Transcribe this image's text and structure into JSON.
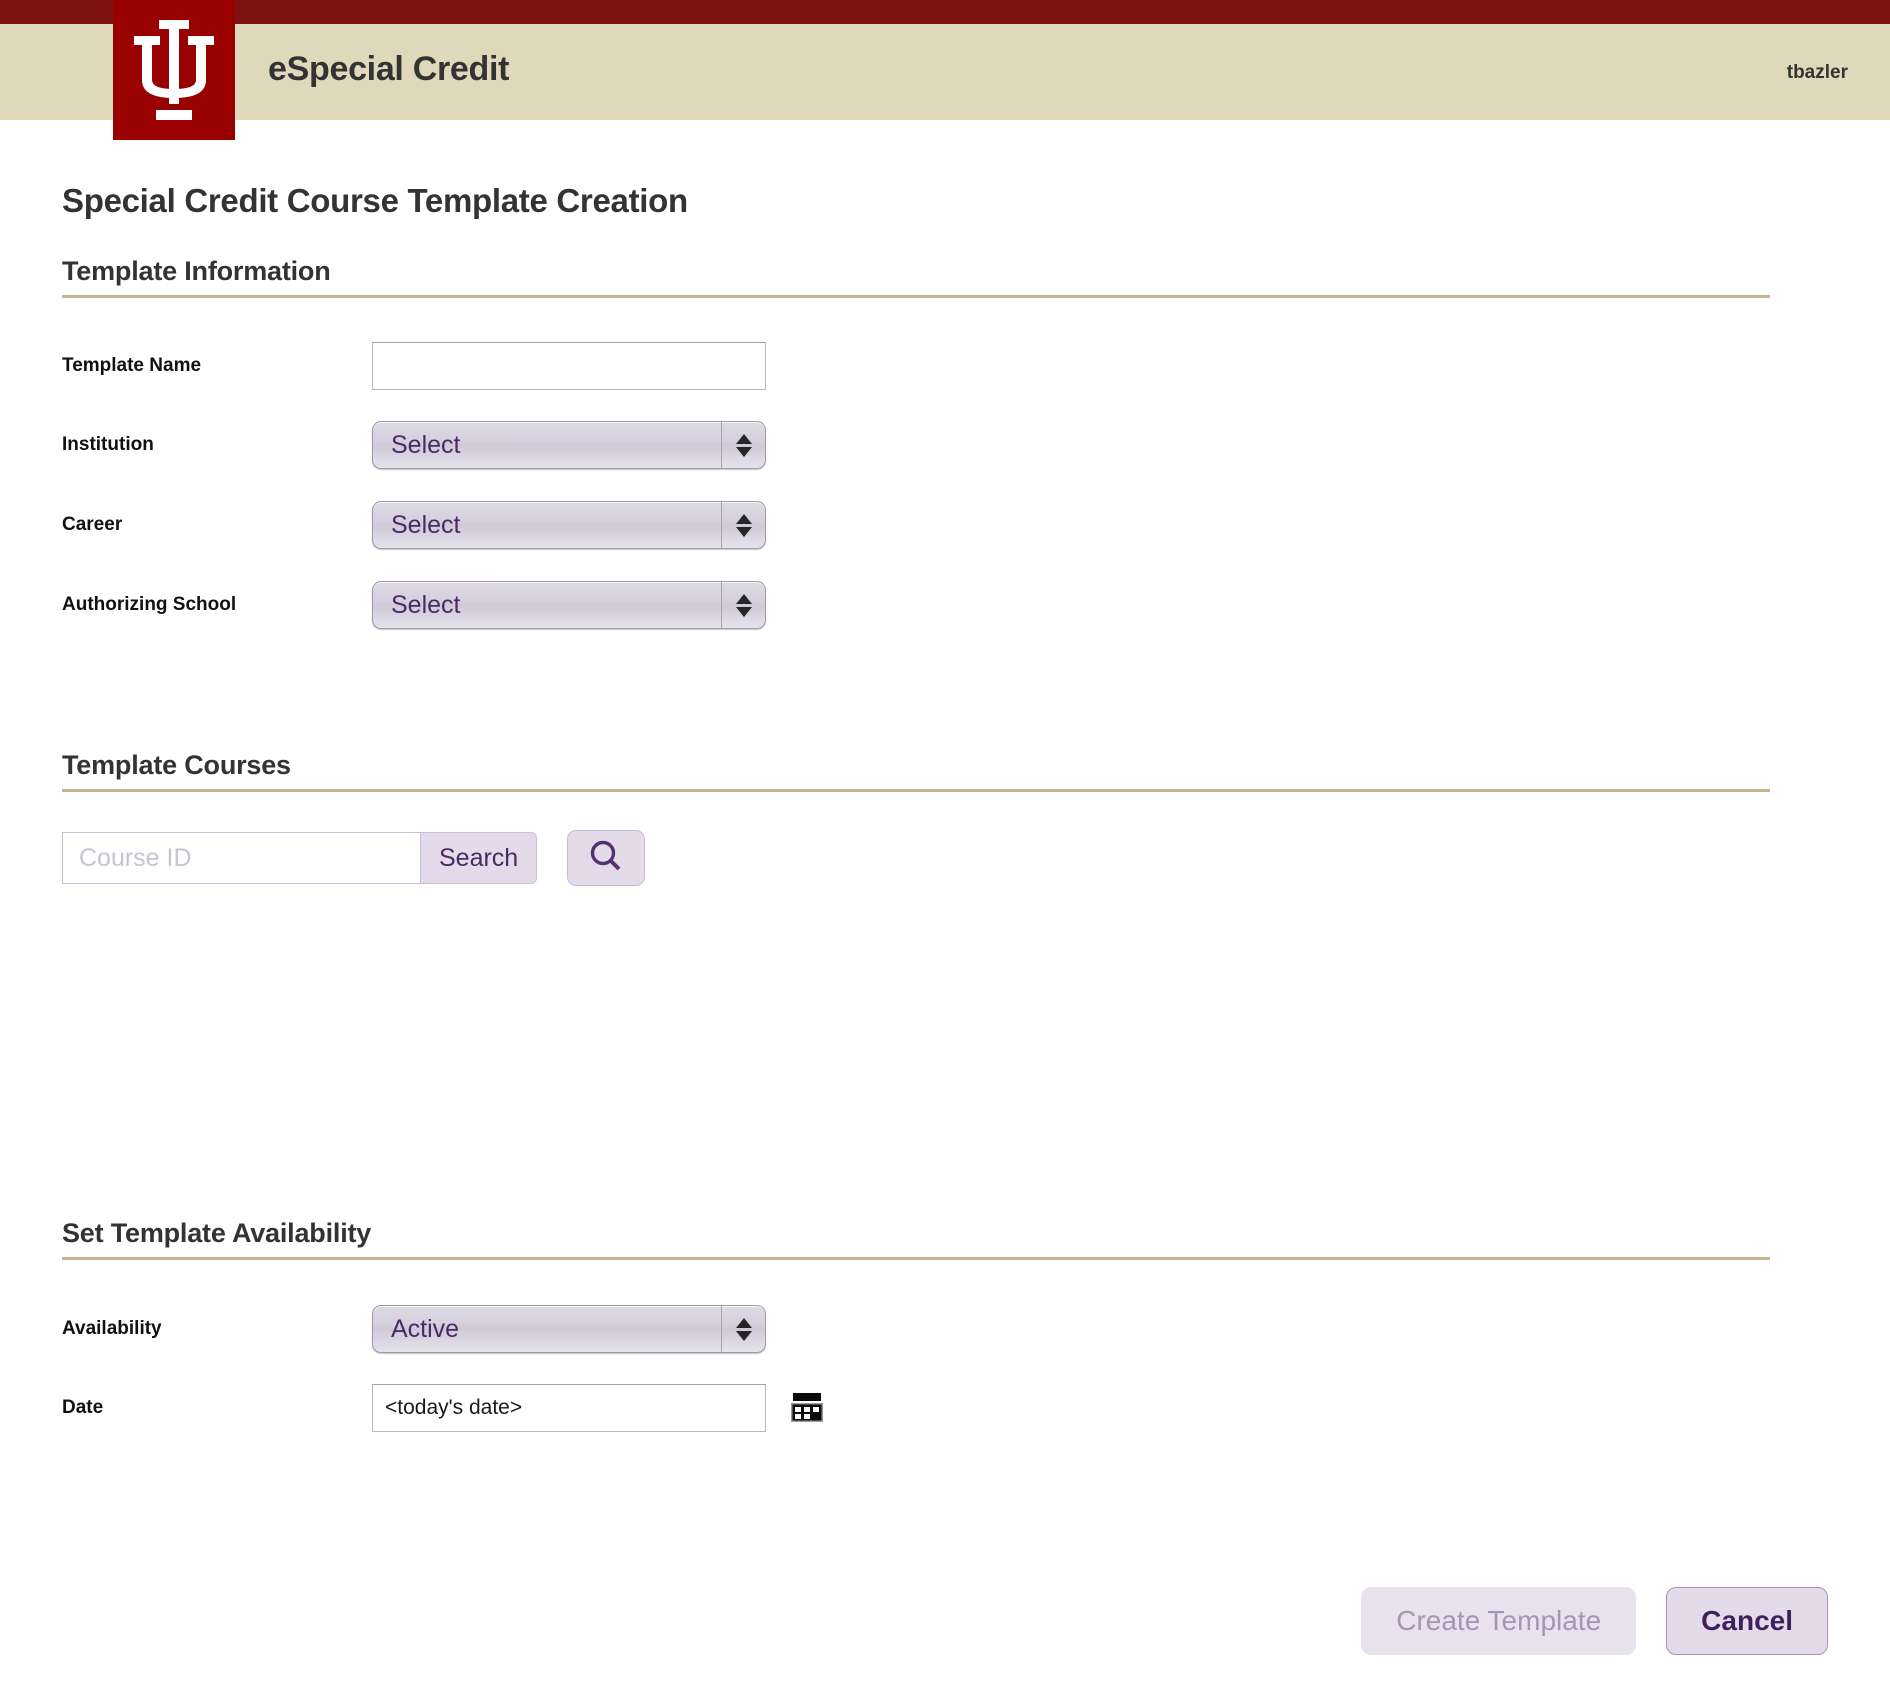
{
  "header": {
    "app_title": "eSpecial Credit",
    "username": "tbazler",
    "logo_icon": "iu-trident-logo",
    "strip_color": "#7d1210",
    "band_color": "#e0d8bb",
    "logo_color": "#990000"
  },
  "page": {
    "title": "Special Credit Course Template Creation",
    "rule_color": "#c5b68f"
  },
  "sections": {
    "template_information": {
      "title": "Template Information",
      "fields": {
        "template_name": {
          "label": "Template Name",
          "value": "",
          "placeholder": ""
        },
        "institution": {
          "label": "Institution",
          "value": "Select"
        },
        "career": {
          "label": "Career",
          "value": "Select"
        },
        "authorizing_school": {
          "label": "Authorizing School",
          "value": "Select"
        }
      }
    },
    "template_courses": {
      "title": "Template Courses",
      "search": {
        "placeholder": "Course ID",
        "value": "",
        "button_label": "Search",
        "magnifier_icon": "search-icon"
      }
    },
    "set_template_availability": {
      "title": "Set Template Availability",
      "fields": {
        "availability": {
          "label": "Availability",
          "value": "Active"
        },
        "date": {
          "label": "Date",
          "value": "<today's date>",
          "calendar_icon": "calendar-icon"
        }
      }
    }
  },
  "actions": {
    "create_label": "Create Template",
    "cancel_label": "Cancel"
  }
}
